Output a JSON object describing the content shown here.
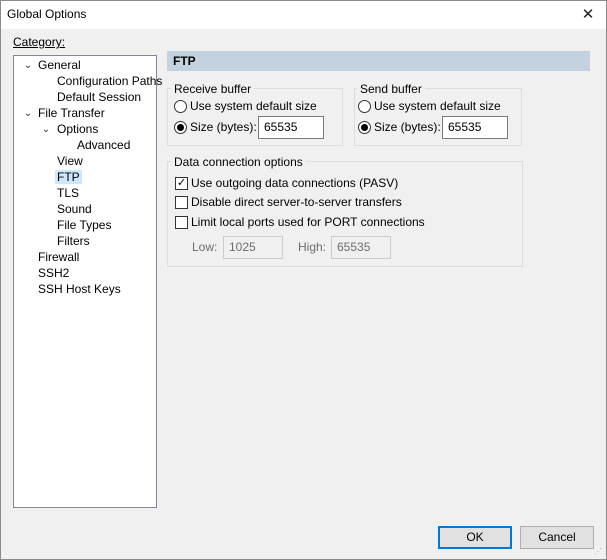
{
  "window": {
    "title": "Global Options",
    "close_glyph": "✕"
  },
  "category_label": "Category:",
  "tree": [
    {
      "label": "General",
      "expanded": true
    },
    {
      "label": "Configuration Paths"
    },
    {
      "label": "Default Session"
    },
    {
      "label": "File Transfer",
      "expanded": true
    },
    {
      "label": "Options",
      "expanded": true
    },
    {
      "label": "Advanced"
    },
    {
      "label": "View"
    },
    {
      "label": "FTP",
      "selected": true
    },
    {
      "label": "TLS"
    },
    {
      "label": "Sound"
    },
    {
      "label": "File Types"
    },
    {
      "label": "Filters"
    },
    {
      "label": "Firewall"
    },
    {
      "label": "SSH2"
    },
    {
      "label": "SSH Host Keys"
    }
  ],
  "panel": {
    "header": "FTP",
    "receive_buffer": {
      "title": "Receive buffer",
      "opt_default": "Use system default size",
      "opt_size": "Size (bytes):",
      "size_value": "65535",
      "selected": "size"
    },
    "send_buffer": {
      "title": "Send buffer",
      "opt_default": "Use system default size",
      "opt_size": "Size (bytes):",
      "size_value": "65535",
      "selected": "size"
    },
    "data_connection": {
      "title": "Data connection options",
      "opt_pasv": "Use outgoing data connections (PASV)",
      "opt_pasv_checked": true,
      "opt_disable_direct": "Disable direct server-to-server transfers",
      "opt_disable_direct_checked": false,
      "opt_limit_ports": "Limit local ports used for PORT connections",
      "opt_limit_ports_checked": false,
      "low_label": "Low:",
      "low_value": "1025",
      "high_label": "High:",
      "high_value": "65535"
    }
  },
  "buttons": {
    "ok": "OK",
    "cancel": "Cancel"
  },
  "icons": {
    "chevron": "chevron-down-icon",
    "check": "checkmark-icon"
  }
}
